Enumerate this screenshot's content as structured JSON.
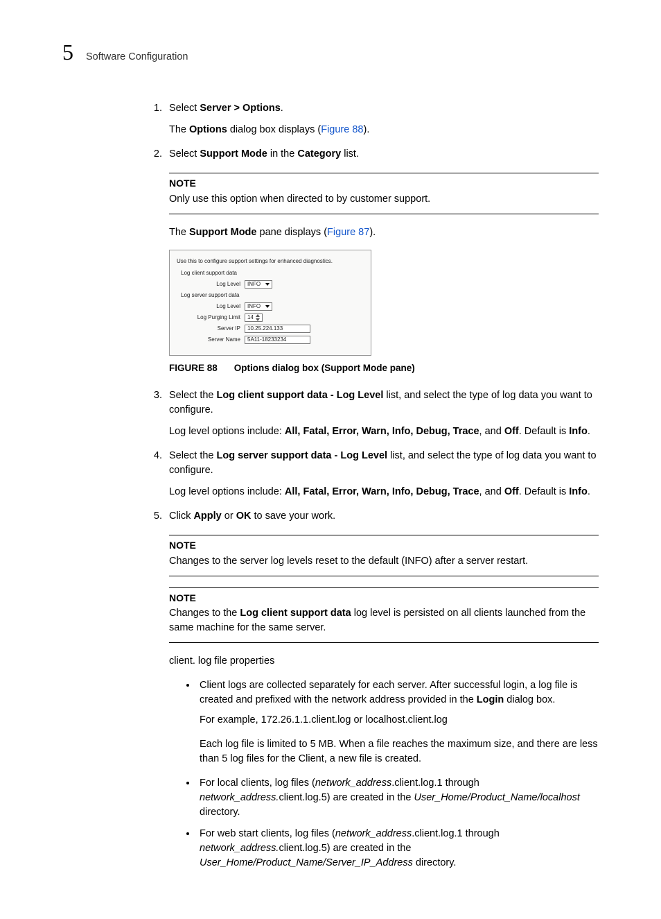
{
  "header": {
    "chapter_number": "5",
    "title": "Software Configuration"
  },
  "steps": {
    "s1": {
      "prefix": "Select ",
      "bold": "Server > Options",
      "suffix": ".",
      "sub_prefix": "The ",
      "sub_bold": "Options",
      "sub_mid": " dialog box displays (",
      "sub_link": "Figure 88",
      "sub_suffix": ")."
    },
    "s2": {
      "prefix": "Select ",
      "bold1": "Support Mode",
      "mid": " in the ",
      "bold2": "Category",
      "suffix": " list.",
      "note_label": "NOTE",
      "note_text": "Only use this option when directed to by customer support.",
      "after_note_prefix": "The ",
      "after_note_bold": "Support Mode",
      "after_note_mid": " pane displays (",
      "after_note_link": "Figure 87",
      "after_note_suffix": ")."
    },
    "figure": {
      "desc": "Use this to configure support settings for enhanced diagnostics.",
      "client_section": "Log client support data",
      "server_section": "Log server support data",
      "loglevel_label": "Log Level",
      "loglevel_value": "INFO",
      "purging_label": "Log Purging Limit",
      "purging_value": "14",
      "serverip_label": "Server IP",
      "serverip_value": "10.25.224.133",
      "servername_label": "Server Name",
      "servername_value": "5A11-18233234"
    },
    "figure_caption": {
      "label": "FIGURE 88",
      "text": "Options dialog box (Support Mode pane)"
    },
    "s3": {
      "prefix": "Select the ",
      "bold": "Log client support data - Log Level",
      "suffix": " list, and select the type of log data you want to configure.",
      "sub_prefix": "Log level options include: ",
      "opts": "All, Fatal, Error, Warn, Info, Debug, Trace",
      "sub_mid": ", and ",
      "off": "Off",
      "sub_mid2": ". Default is ",
      "default": "Info",
      "sub_suffix": "."
    },
    "s4": {
      "prefix": "Select the ",
      "bold": "Log server support data - Log Level",
      "suffix": " list, and select the type of log data you want to configure.",
      "sub_prefix": "Log level options include: ",
      "opts": "All, Fatal, Error, Warn, Info, Debug, Trace",
      "sub_mid": ", and ",
      "off": "Off",
      "sub_mid2": ". Default is ",
      "default": "Info",
      "sub_suffix": "."
    },
    "s5": {
      "prefix": "Click ",
      "bold1": "Apply",
      "mid": " or ",
      "bold2": "OK",
      "suffix": " to save your work.",
      "note1_label": "NOTE",
      "note1_text": "Changes to the server log levels reset to the default (INFO) after a server restart.",
      "note2_label": "NOTE",
      "note2_prefix": "Changes to the ",
      "note2_bold": "Log client support data",
      "note2_suffix": " log level is persisted on all clients launched from the same machine for the same server."
    }
  },
  "after": {
    "client_log_heading": "client. log file properties",
    "b1": {
      "prefix": "Client logs are collected separately for each server. After successful login, a log file is created and prefixed with the network address provided in the ",
      "bold": "Login",
      "suffix": " dialog box.",
      "sub1": "For example, 172.26.1.1.client.log or localhost.client.log",
      "sub2": "Each log file is limited to 5 MB. When a file reaches the maximum size, and there are less than 5 log files for the Client, a new file is created."
    },
    "b2": {
      "prefix": "For local clients, log files (",
      "it1": "network_address",
      "mid1": ".client.log.1 through ",
      "it2": "network_address.",
      "mid2": "client.log.5) are created in the ",
      "it3": "User_Home/Product_Name/localhost",
      "suffix": " directory."
    },
    "b3": {
      "prefix": "For web start clients, log files (",
      "it1": "network_address",
      "mid1": ".client.log.1 through ",
      "it2": "network_address.",
      "mid2": "client.log.5) are created in the ",
      "it3": "User_Home/Product_Name/Server_IP_Address",
      "suffix": " directory."
    }
  }
}
